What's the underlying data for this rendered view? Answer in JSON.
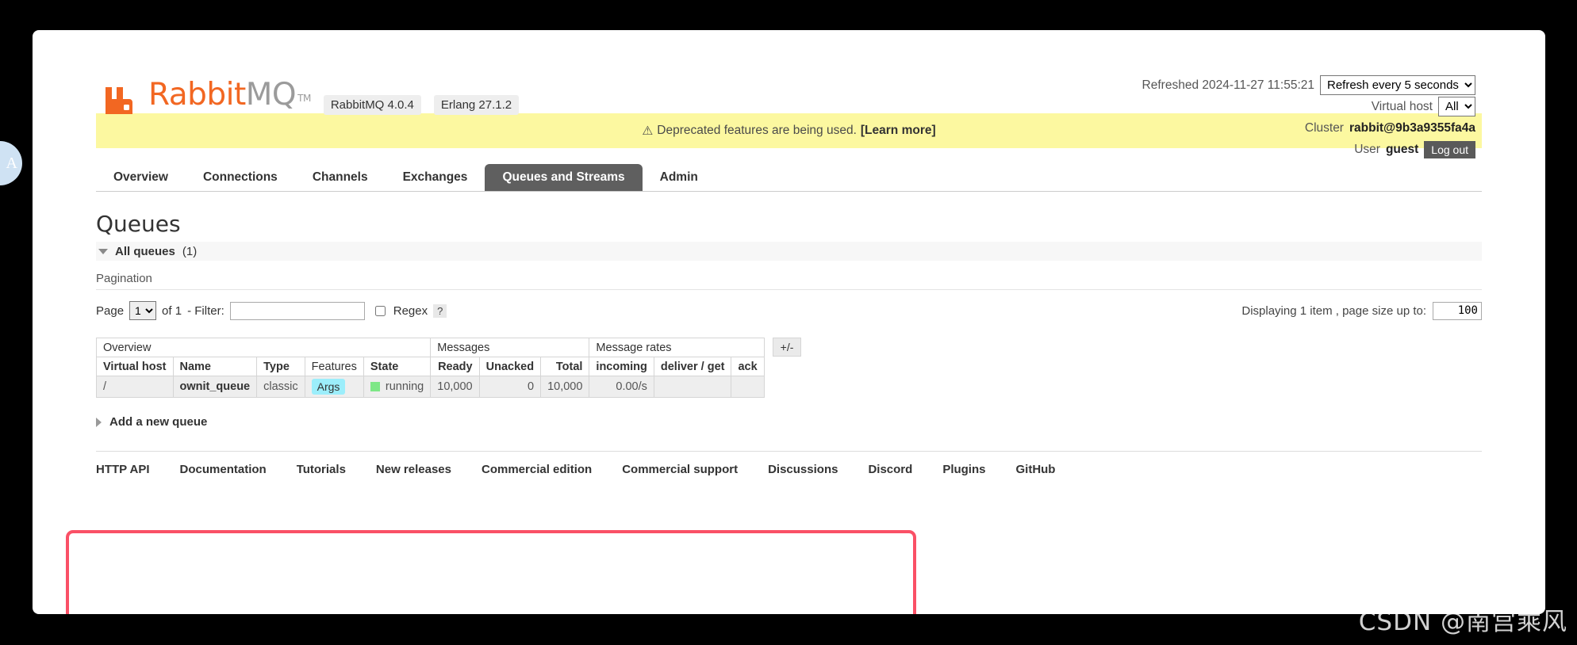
{
  "left_badge": {
    "label": "A"
  },
  "header": {
    "logo": {
      "orange_text": "Rabbit",
      "grey_text": "MQ",
      "tm": "TM",
      "icon": "rabbitmq-logo-icon"
    },
    "version_badges": [
      "RabbitMQ 4.0.4",
      "Erlang 27.1.2"
    ],
    "refreshed_label": "Refreshed 2024-11-27 11:55:21",
    "refresh_select": {
      "value": "Refresh every 5 seconds"
    },
    "vhost_label": "Virtual host",
    "vhost_select": {
      "value": "All"
    },
    "cluster_label": "Cluster",
    "cluster_value": "rabbit@9b3a9355fa4a",
    "user_label": "User",
    "user_value": "guest",
    "logout_label": "Log out"
  },
  "banner": {
    "icon": "warning-triangle-icon",
    "text": "Deprecated features are being used.",
    "link": "[Learn more]",
    "background": "#fcf8a0"
  },
  "tabs": [
    {
      "label": "Overview",
      "active": false
    },
    {
      "label": "Connections",
      "active": false
    },
    {
      "label": "Channels",
      "active": false
    },
    {
      "label": "Exchanges",
      "active": false
    },
    {
      "label": "Queues and Streams",
      "active": true
    },
    {
      "label": "Admin",
      "active": false
    }
  ],
  "main": {
    "title": "Queues",
    "all_queues_label": "All queues",
    "all_queues_count": "(1)",
    "pagination_label": "Pagination",
    "page_label": "Page",
    "page_value": "1",
    "of_label": "of 1",
    "filter_label": "- Filter:",
    "filter_value": "",
    "filter_placeholder": "",
    "regex_label": "Regex",
    "regex_help": "?",
    "displaying_label": "Displaying 1 item , page size up to:",
    "page_size_value": "100",
    "plus_minus": "+/-",
    "add_queue_label": "Add a new queue"
  },
  "table": {
    "group_headers": [
      {
        "label": "Overview",
        "span": 5
      },
      {
        "label": "Messages",
        "span": 3
      },
      {
        "label": "Message rates",
        "span": 3
      }
    ],
    "columns": [
      {
        "label": "Virtual host",
        "bold": true
      },
      {
        "label": "Name",
        "bold": true
      },
      {
        "label": "Type",
        "bold": true
      },
      {
        "label": "Features",
        "bold": false
      },
      {
        "label": "State",
        "bold": true
      },
      {
        "label": "Ready",
        "bold": true
      },
      {
        "label": "Unacked",
        "bold": true
      },
      {
        "label": "Total",
        "bold": true
      },
      {
        "label": "incoming",
        "bold": true
      },
      {
        "label": "deliver / get",
        "bold": true
      },
      {
        "label": "ack",
        "bold": true
      }
    ],
    "rows": [
      {
        "virtual_host": "/",
        "name": "ownit_queue",
        "type": "classic",
        "features": "Args",
        "state": "running",
        "state_color": "#7ee787",
        "ready": "10,000",
        "unacked": "0",
        "total": "10,000",
        "incoming": "0.00/s",
        "deliver_get": "",
        "ack": ""
      }
    ]
  },
  "footer_links": [
    "HTTP API",
    "Documentation",
    "Tutorials",
    "New releases",
    "Commercial edition",
    "Commercial support",
    "Discussions",
    "Discord",
    "Plugins",
    "GitHub"
  ],
  "annotation": {
    "box_color": "#fa5066"
  },
  "watermark": {
    "text": "CSDN @南宫乘风"
  }
}
